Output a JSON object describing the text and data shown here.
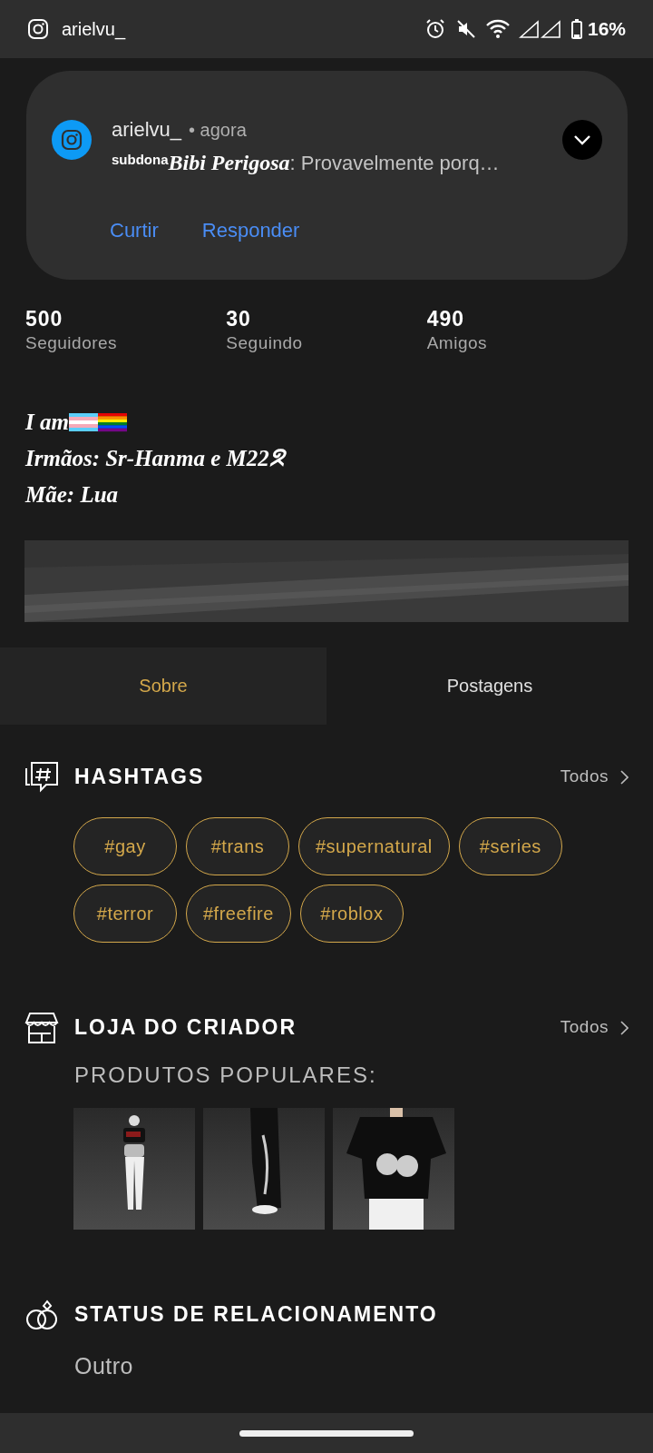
{
  "status_bar": {
    "app_name": "arielvu_",
    "battery": "16%"
  },
  "notification": {
    "title": "arielvu_",
    "time": "• agora",
    "sender_prefix": "subdona",
    "sender": "Bibi Perigosa",
    "message": ": Provavelmente porq…",
    "actions": [
      "Curtir",
      "Responder"
    ]
  },
  "stats": [
    {
      "value": "500",
      "label": "Seguidores"
    },
    {
      "value": "30",
      "label": "Seguindo"
    },
    {
      "value": "490",
      "label": "Amigos"
    }
  ],
  "bio": [
    {
      "text": "I am",
      "flags": true
    },
    {
      "text": "Irmãos: Sr-Hanma e M22ᘝ",
      "flags": false
    },
    {
      "text": "Mãe: Lua",
      "flags": false
    }
  ],
  "tabs": [
    {
      "label": "Sobre",
      "selected": true
    },
    {
      "label": "Postagens",
      "selected": false
    }
  ],
  "hashtags": {
    "title": "HASHTAGS",
    "more": "Todos",
    "tags": [
      "#gay",
      "#trans",
      "#supernatural",
      "#series",
      "#terror",
      "#freefire",
      "#roblox"
    ]
  },
  "shop": {
    "title": "LOJA DO CRIADOR",
    "more": "Todos",
    "subtitle": "PRODUTOS POPULARES:"
  },
  "relationship": {
    "title": "STATUS DE RELACIONAMENTO",
    "value": "Outro"
  }
}
